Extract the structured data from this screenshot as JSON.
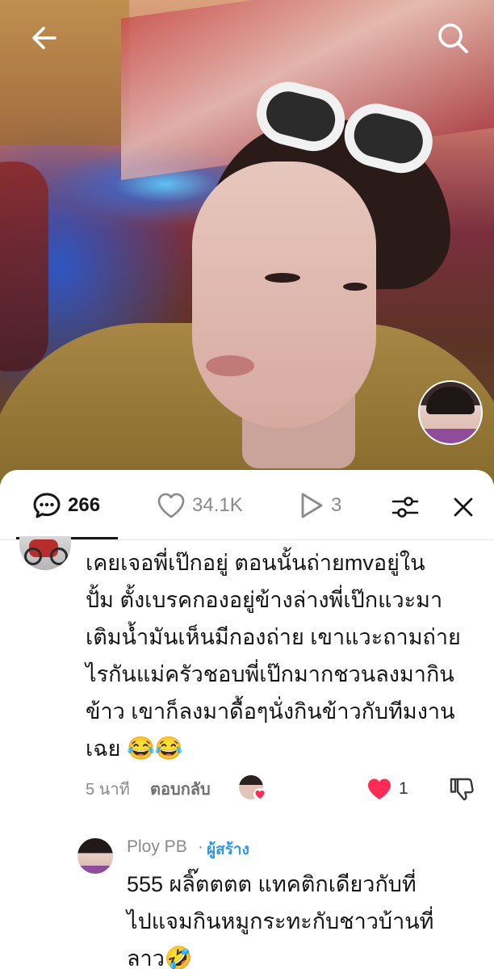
{
  "video": {},
  "tabs": {
    "comments_count": "266",
    "likes_count": "34.1K",
    "views_count": "3",
    "comments_icon": "comment-bubble-icon",
    "likes_icon": "heart-outline-icon",
    "views_icon": "play-icon"
  },
  "comment": {
    "text": "เคยเจอพี่เป๊กอยู่ ตอนนั้นถ่ายmvอยู่ใน\nปั้ม ตั้งเบรคกองอยู่ข้างล่างพี่เป๊กแวะมา\nเติมน้ำมันเห็นมีกองถ่าย เขาแวะถามถ่าย\nไรกันแม่ครัวชอบพี่เป๊กมากชวนลงมากิน\nข้าว เขาก็ลงมาดื้อๆนั่งกินข้าวกับทีมงาน\nเฉย ",
    "emoji": "😂😂",
    "time": "5 นาที",
    "reply_label": "ตอบกลับ",
    "like_count": "1"
  },
  "reply": {
    "name": "Ploy PB",
    "dot": "·",
    "creator_label": "ผู้สร้าง",
    "text": "555 ผลิ๊ตตตต แทคติกเดียวกับที่\nไปแจมกินหมูกระทะกับชาวบ้านที่\nลาว",
    "emoji": "🤣"
  },
  "colors": {
    "like_red": "#fe2c55",
    "creator_blue": "#2f97e8",
    "text_primary": "#161616",
    "text_secondary": "#8a8a8a"
  }
}
